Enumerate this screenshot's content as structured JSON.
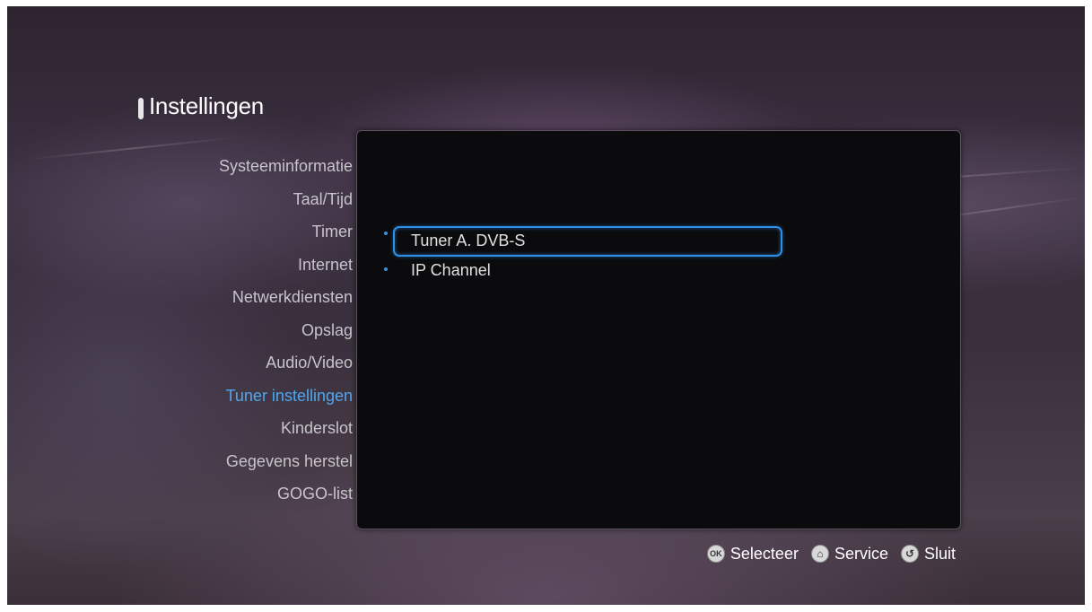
{
  "header": {
    "title": "Instellingen"
  },
  "sidebar": {
    "items": [
      {
        "label": "Systeeminformatie"
      },
      {
        "label": "Taal/Tijd"
      },
      {
        "label": "Timer"
      },
      {
        "label": "Internet"
      },
      {
        "label": "Netwerkdiensten"
      },
      {
        "label": "Opslag"
      },
      {
        "label": "Audio/Video"
      },
      {
        "label": "Tuner instellingen",
        "active": true
      },
      {
        "label": "Kinderslot"
      },
      {
        "label": "Gegevens herstel"
      },
      {
        "label": "GOGO-list"
      }
    ]
  },
  "panel": {
    "options": [
      {
        "label": "Tuner A. DVB-S",
        "selected": true
      },
      {
        "label": "IP Channel"
      }
    ]
  },
  "footer": {
    "hints": [
      {
        "icon": "ok-button-icon",
        "key_text": "OK",
        "label": "Selecteer"
      },
      {
        "icon": "home-button-icon",
        "key_text": "⌂",
        "label": "Service"
      },
      {
        "icon": "back-button-icon",
        "key_text": "↺",
        "label": "Sluit"
      }
    ]
  },
  "colors": {
    "accent": "#2f8ee6",
    "active_text": "#4fa6ee",
    "menu_text": "#c8c4cc"
  }
}
